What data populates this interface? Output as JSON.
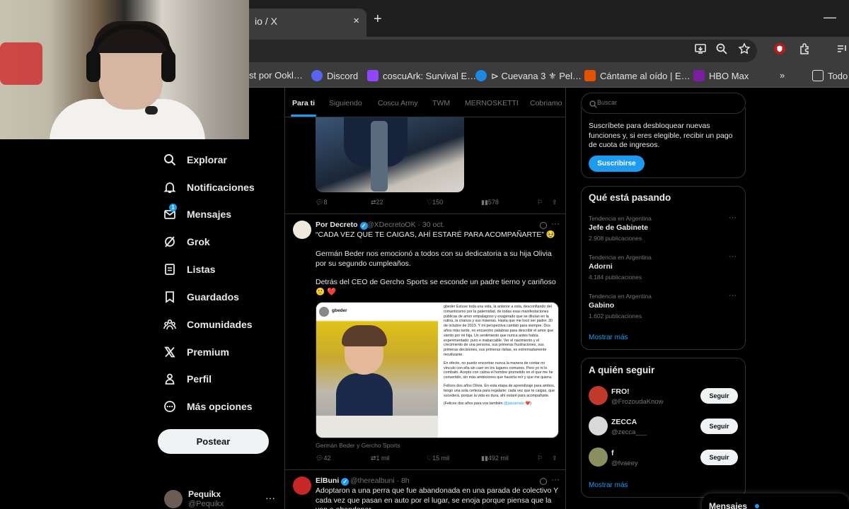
{
  "browser": {
    "tab_title": "io / X",
    "tab_close": "×",
    "new_tab": "+",
    "minimize": "—",
    "bookmarks": [
      {
        "label": "st por Ookl…",
        "color": "#3c3c3c"
      },
      {
        "label": "Discord",
        "color": "#5865f2"
      },
      {
        "label": "coscuArk: Survival E…",
        "color": "#9146ff"
      },
      {
        "label": "⊳ Cuevana 3 ⚜ Pel…",
        "color": "#1e88e5"
      },
      {
        "label": "Cántame al oído | E…",
        "color": "#e65100"
      },
      {
        "label": "HBO Max",
        "color": "#7b1fa2"
      },
      {
        "label": "Todo",
        "color": "#3c3c3c"
      }
    ],
    "bookmarks_overflow": "»"
  },
  "nav": {
    "items": [
      {
        "label": "Explorar",
        "icon": "search-icon"
      },
      {
        "label": "Notificaciones",
        "icon": "bell-icon"
      },
      {
        "label": "Mensajes",
        "icon": "mail-icon",
        "badge": "1"
      },
      {
        "label": "Grok",
        "icon": "grok-icon"
      },
      {
        "label": "Listas",
        "icon": "list-icon"
      },
      {
        "label": "Guardados",
        "icon": "bookmark-icon"
      },
      {
        "label": "Comunidades",
        "icon": "communities-icon"
      },
      {
        "label": "Premium",
        "icon": "x-logo-icon"
      },
      {
        "label": "Perfil",
        "icon": "person-icon"
      },
      {
        "label": "Más opciones",
        "icon": "more-circle-icon"
      }
    ],
    "post_button": "Postear",
    "account": {
      "name": "Pequikx",
      "handle": "@Pequikx",
      "more": "···"
    }
  },
  "timeline": {
    "tabs": [
      "Para ti",
      "Siguiendo",
      "Coscu Army",
      "TWM",
      "MERNOSKETTI",
      "Cobriamo"
    ],
    "active_tab": "Para ti",
    "tweet1_actions": {
      "replies": "8",
      "reposts": "22",
      "likes": "150",
      "views": "578"
    },
    "tweet2": {
      "name": "Por Decreto",
      "handle": "@XDecretoOK · 30 oct.",
      "line1": "“CADA VEZ QUE TE CAIGAS, AHÍ ESTARÉ PARA ACOMPAÑARTE” 🥹",
      "line2": "Germán Beder nos emocionó a todos con su dedicatoria a su hija Olivia por su segundo cumpleaños.",
      "line3": "Detrás del CEO de Gercho Sports se esconde un padre tierno y cariñoso 🙂 ❤️",
      "image_account": "gbeder",
      "image_text_1": "gbeder Estuve toda una vida, la anterior a esta, desconfiando del romanticismo por la paternidad, de todas esas manifestaciones públicas de amor empalagoso y exagerado que se diluían en la rutina, la crianza y sus miserias. Hasta que me tocó ser padre: 30 de octubre de 2023. Y mi perspectiva cambió para siempre. Dos años más tarde, no encuentro palabras para describir el amor que siento por mi hija. Un sentimiento que nunca antes había experimentado: puro e inabarcable. Ver el nacimiento y el crecimiento de una persona, sus primeras frustraciones, sus primeras decisiones, sus primeras risitas, es extremadamente movilizante.",
      "image_text_2": "En efecto, no puedo encontrar nunca la manera de contar mi vínculo con ella sin caer en los lugares comunes. Pero yo ni lo combato. Acepto con calma el hombre prometido en el que me he convertido, sin más ambiciones que hacerla reír y que me quiera.",
      "image_text_3": "Felices dos años Olivia. En esta etapa de aprendizaje para ambos, tengo una sola certeza para regalarte: cada vez que te caigas, que sucederá, porque la vida es dura, ahí estaré para acompañarte.",
      "image_text_4": "(Felices dos años para vos también",
      "image_text_link": "@pauamato",
      "image_text_end": "❤️)",
      "caption": "Germán Beder y Gercho Sports",
      "actions": {
        "replies": "42",
        "reposts": "1 mil",
        "likes": "15 mil",
        "views": "492 mil"
      }
    },
    "tweet3": {
      "name": "ElBuni",
      "handle": "@therealbuni · 8h",
      "text": "Adoptaron a una perra que fue abandonada en una parada de colectivo Y cada vez que pasan en auto por el lugar, se enoja porque piensa que la van a abandonar"
    }
  },
  "right": {
    "search_placeholder": "Buscar",
    "premium_text": "Suscríbete para desbloquear nuevas funciones y, si eres elegible, recibir un pago de cuota de ingresos.",
    "subscribe_button": "Suscribirse",
    "trending_title": "Qué está pasando",
    "trends": [
      {
        "context": "Tendencia en Argentina",
        "name": "Jefe de Gabinete",
        "count": "2.908 publicaciones"
      },
      {
        "context": "Tendencia en Argentina",
        "name": "Adorni",
        "count": "4.184 publicaciones"
      },
      {
        "context": "Tendencia en Argentina",
        "name": "Gabino",
        "count": "1.602 publicaciones"
      }
    ],
    "show_more": "Mostrar más",
    "follow_title": "A quién seguir",
    "follow": [
      {
        "name": "FRO!",
        "handle": "@FrozoudaKnow",
        "color": "#c0392b"
      },
      {
        "name": "ZECCA",
        "handle": "@zecca___",
        "color": "#ddd"
      },
      {
        "name": "f",
        "handle": "@fvaeey",
        "color": "#8a8f60"
      }
    ],
    "follow_button": "Seguir",
    "messages": "Mensajes"
  },
  "colors": {
    "accent": "#1d9bf0",
    "background": "#000000",
    "border": "#2f3336",
    "muted": "#71767b"
  }
}
